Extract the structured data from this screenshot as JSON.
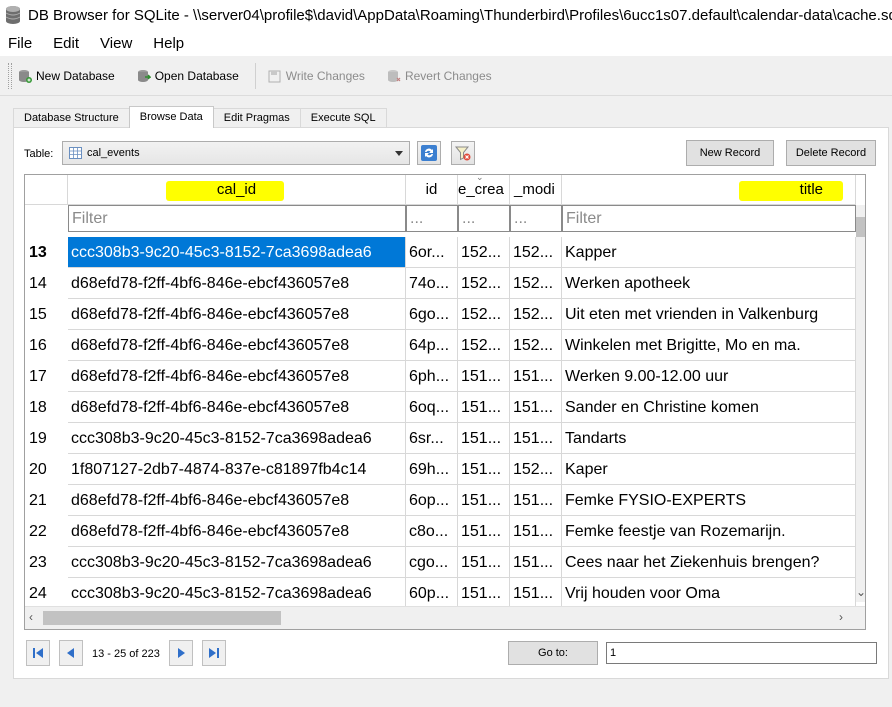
{
  "window": {
    "title": "DB Browser for SQLite - \\\\server04\\profile$\\david\\AppData\\Roaming\\Thunderbird\\Profiles\\6ucc1s07.default\\calendar-data\\cache.sqlite"
  },
  "menu": [
    "File",
    "Edit",
    "View",
    "Help"
  ],
  "toolbar": {
    "new_database": "New Database",
    "open_database": "Open Database",
    "write_changes": "Write Changes",
    "revert_changes": "Revert Changes"
  },
  "tabs": [
    "Database Structure",
    "Browse Data",
    "Edit Pragmas",
    "Execute SQL"
  ],
  "browse": {
    "table_label": "Table:",
    "table_selected": "cal_events",
    "new_record": "New Record",
    "delete_record": "Delete Record"
  },
  "columns": [
    {
      "label": "cal_id",
      "filter": "Filter"
    },
    {
      "label": "id",
      "filter": "..."
    },
    {
      "label": "e_crea",
      "filter": "..."
    },
    {
      "label": "_modi",
      "filter": "..."
    },
    {
      "label": "title",
      "filter": "Filter"
    }
  ],
  "rows": [
    {
      "num": "13",
      "cal_id": "ccc308b3-9c20-45c3-8152-7ca3698adea6",
      "id": "6or...",
      "created": "152...",
      "modified": "152...",
      "title": "Kapper"
    },
    {
      "num": "14",
      "cal_id": "d68efd78-f2ff-4bf6-846e-ebcf436057e8",
      "id": "74o...",
      "created": "152...",
      "modified": "152...",
      "title": "Werken apotheek"
    },
    {
      "num": "15",
      "cal_id": "d68efd78-f2ff-4bf6-846e-ebcf436057e8",
      "id": "6go...",
      "created": "152...",
      "modified": "152...",
      "title": "Uit eten met vrienden in Valkenburg"
    },
    {
      "num": "16",
      "cal_id": "d68efd78-f2ff-4bf6-846e-ebcf436057e8",
      "id": "64p...",
      "created": "152...",
      "modified": "152...",
      "title": "Winkelen met Brigitte, Mo en ma."
    },
    {
      "num": "17",
      "cal_id": "d68efd78-f2ff-4bf6-846e-ebcf436057e8",
      "id": "6ph...",
      "created": "151...",
      "modified": "151...",
      "title": "Werken 9.00-12.00 uur"
    },
    {
      "num": "18",
      "cal_id": "d68efd78-f2ff-4bf6-846e-ebcf436057e8",
      "id": "6oq...",
      "created": "151...",
      "modified": "151...",
      "title": "Sander en Christine komen"
    },
    {
      "num": "19",
      "cal_id": "ccc308b3-9c20-45c3-8152-7ca3698adea6",
      "id": "6sr...",
      "created": "151...",
      "modified": "151...",
      "title": "Tandarts"
    },
    {
      "num": "20",
      "cal_id": "1f807127-2db7-4874-837e-c81897fb4c14",
      "id": "69h...",
      "created": "151...",
      "modified": "152...",
      "title": "Kaper"
    },
    {
      "num": "21",
      "cal_id": "d68efd78-f2ff-4bf6-846e-ebcf436057e8",
      "id": "6op...",
      "created": "151...",
      "modified": "151...",
      "title": "Femke FYSIO-EXPERTS"
    },
    {
      "num": "22",
      "cal_id": "d68efd78-f2ff-4bf6-846e-ebcf436057e8",
      "id": "c8o...",
      "created": "151...",
      "modified": "151...",
      "title": "Femke feestje van Rozemarijn."
    },
    {
      "num": "23",
      "cal_id": "ccc308b3-9c20-45c3-8152-7ca3698adea6",
      "id": "cgo...",
      "created": "151...",
      "modified": "151...",
      "title": "Cees naar het Ziekenhuis brengen?"
    },
    {
      "num": "24",
      "cal_id": "ccc308b3-9c20-45c3-8152-7ca3698adea6",
      "id": "60p...",
      "created": "151...",
      "modified": "151...",
      "title": "Vrij houden voor Oma"
    }
  ],
  "pager": {
    "range_text": "13 - 25 of 223",
    "goto_label": "Go to:",
    "goto_value": "1"
  },
  "colors": {
    "selection": "#0078d7",
    "highlight": "#ffff00"
  }
}
